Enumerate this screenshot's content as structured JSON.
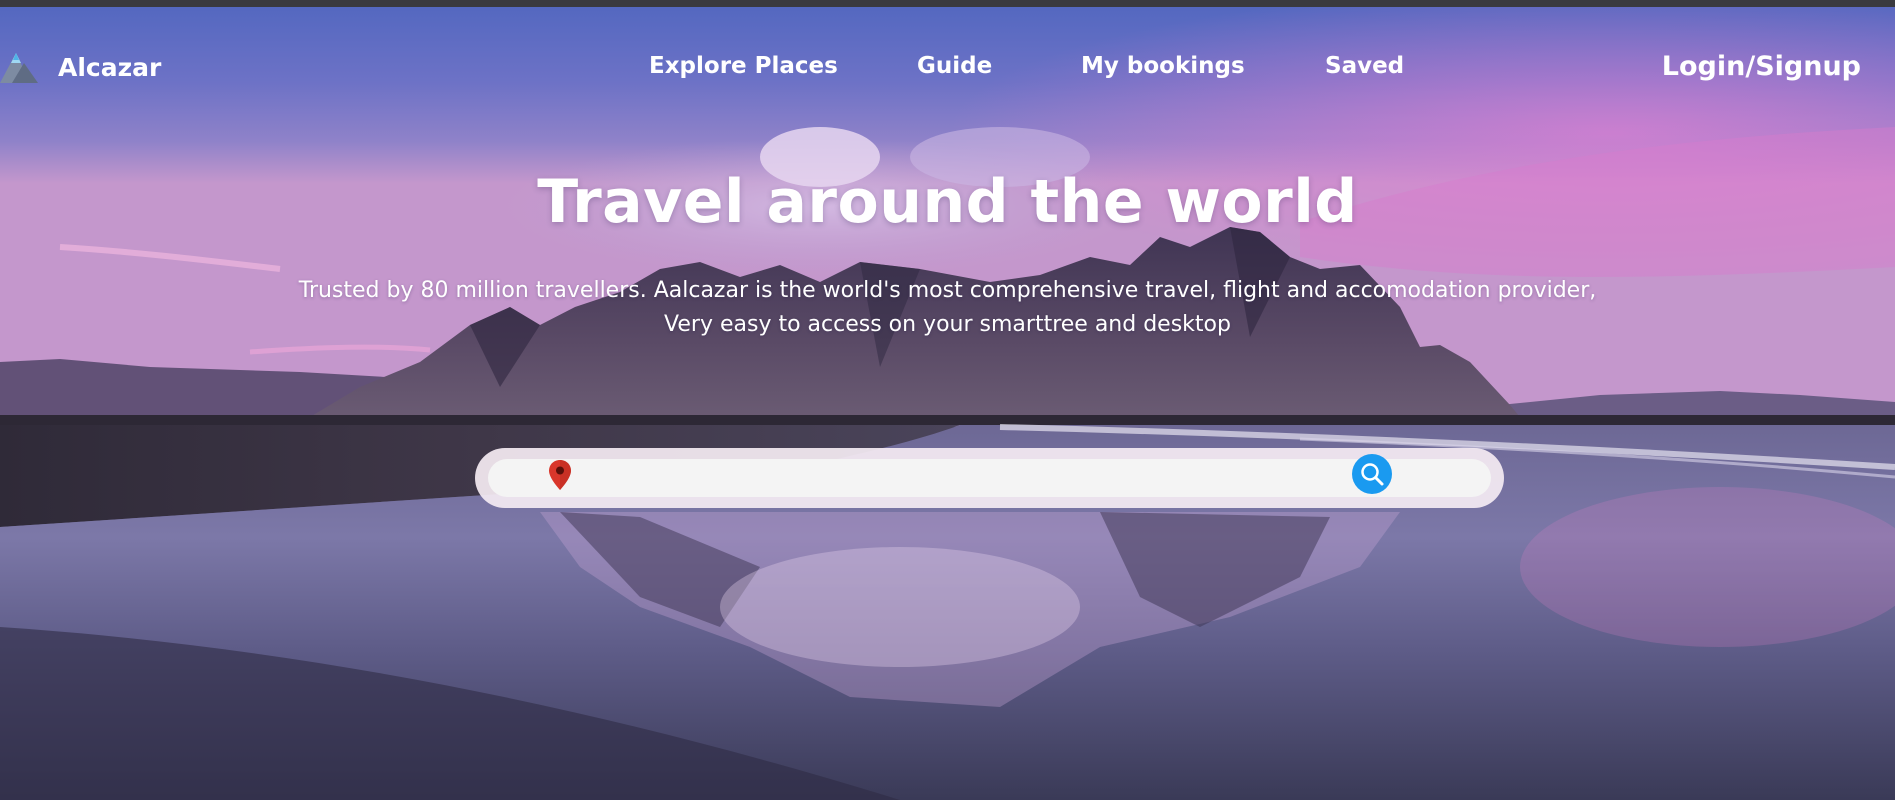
{
  "brand": {
    "name": "Alcazar",
    "logo_icon": "mountain-logo-icon"
  },
  "nav": {
    "links": [
      "Explore Places",
      "Guide",
      "My bookings",
      "Saved"
    ],
    "login_label": "Login/Signup"
  },
  "hero": {
    "title": "Travel around the world",
    "subtitle_line1": "Trusted by 80 million travellers. Aalcazar is the world's most comprehensive travel, flight and accomodation provider,",
    "subtitle_line2": "Very easy to access on your smarttree and desktop"
  },
  "search": {
    "placeholder": "",
    "location_icon": "map-pin-icon",
    "button_icon": "search-icon",
    "button_color": "#1a9af0",
    "pin_color": "#d9362b"
  },
  "theme": {
    "text_color": "#ffffff"
  }
}
